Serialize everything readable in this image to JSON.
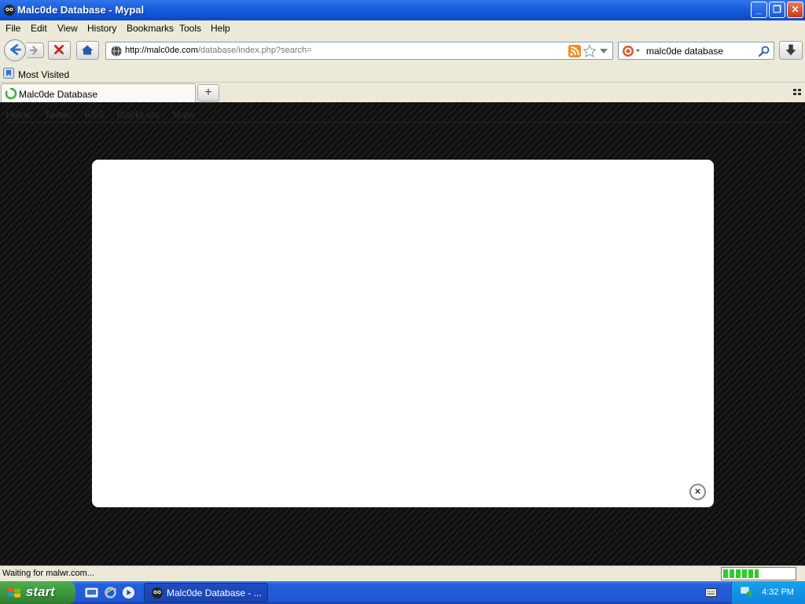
{
  "window": {
    "title": "Malc0de Database - Mypal",
    "minimize_label": "_",
    "maximize_label": "❐",
    "close_label": "✕"
  },
  "menu": {
    "items": [
      "File",
      "Edit",
      "View",
      "History",
      "Bookmarks",
      "Tools",
      "Help"
    ]
  },
  "navbar": {
    "url_host": "http://malc0de.com",
    "url_path": "/database/index.php?search=",
    "search_value": "malc0de database"
  },
  "bookmarks": {
    "items": [
      "Most Visited"
    ]
  },
  "tabs": {
    "items": [
      "Malc0de Database"
    ],
    "new_tab_label": "+"
  },
  "page": {
    "nav_links": [
      "Home",
      "Twitter",
      "RSS",
      "BlackLists",
      "Malw"
    ],
    "modal_close_label": "×"
  },
  "status": {
    "text": "Waiting for malwr.com...",
    "progress_fraction": 0.5
  },
  "taskbar": {
    "start_label": "start",
    "task_label": "Malc0de Database - ...",
    "clock": "4:32 PM"
  },
  "colors": {
    "titlebar": "#0b49c9",
    "chrome": "#ece9d8",
    "taskbar": "#245edb",
    "start": "#3a913a",
    "page_background": "#141414",
    "modal": "#ffffff"
  }
}
